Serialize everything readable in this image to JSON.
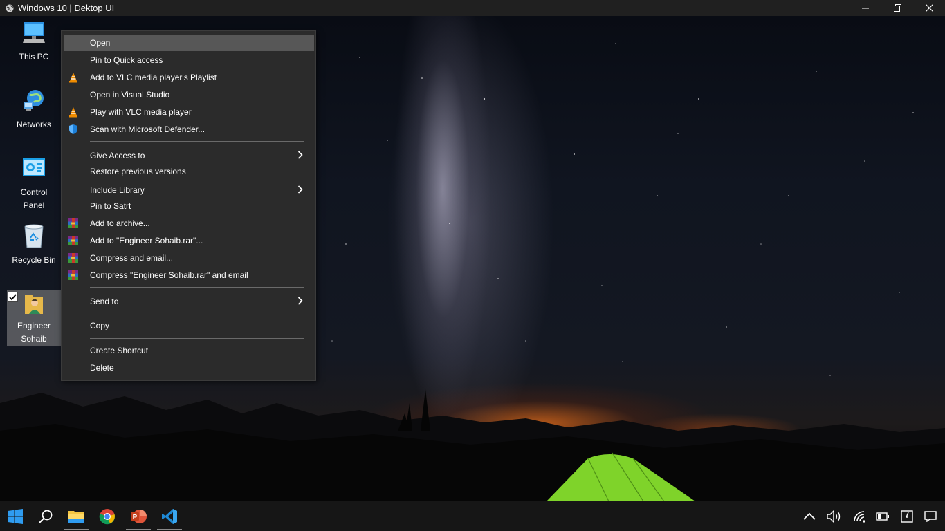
{
  "window": {
    "title": "Windows 10 | Dektop UI"
  },
  "desktop_icons": [
    {
      "label": "This PC",
      "icon": "computer-icon"
    },
    {
      "label": "Networks",
      "icon": "network-icon"
    },
    {
      "label": "Control Panel",
      "icon": "control-panel-icon"
    },
    {
      "label": "Recycle Bin",
      "icon": "recycle-bin-icon"
    },
    {
      "label": "Engineer Sohaib",
      "icon": "user-folder-icon",
      "selected": true,
      "checked": true
    }
  ],
  "context_menu": {
    "items": [
      {
        "label": "Open",
        "highlighted": true
      },
      {
        "label": "Pin to Quick access"
      },
      {
        "label": "Add to VLC media player's Playlist",
        "icon": "vlc-icon"
      },
      {
        "label": "Open in Visual Studio"
      },
      {
        "label": "Play with VLC media player",
        "icon": "vlc-icon"
      },
      {
        "label": "Scan with Microsoft Defender...",
        "icon": "defender-shield-icon"
      },
      {
        "label": "Give Access to",
        "submenu": true
      },
      {
        "label": "Restore previous versions"
      },
      {
        "label": "Include Library",
        "submenu": true
      },
      {
        "label": "Pin to Satrt"
      },
      {
        "label": "Add to archive...",
        "icon": "winrar-icon"
      },
      {
        "label": "Add to \"Engineer Sohaib.rar\"...",
        "icon": "winrar-icon"
      },
      {
        "label": "Compress and email...",
        "icon": "winrar-icon"
      },
      {
        "label": "Compress \"Engineer Sohaib.rar\" and email",
        "icon": "winrar-icon"
      },
      {
        "label": "Send to",
        "submenu": true
      },
      {
        "label": "Copy"
      },
      {
        "label": "Create Shortcut"
      },
      {
        "label": "Delete"
      }
    ]
  },
  "taskbar": {
    "apps": [
      "start-icon",
      "search-icon",
      "file-explorer-icon",
      "chrome-icon",
      "powerpoint-icon",
      "vscode-icon"
    ],
    "tray": [
      "chevron-up-icon",
      "volume-icon",
      "wifi-icon",
      "battery-icon",
      "clock-icon",
      "notification-icon"
    ]
  },
  "colors": {
    "menu_bg": "#2b2b2b",
    "menu_highlight": "#575757",
    "taskbar_bg": "#161616",
    "titlebar_bg": "#202020"
  }
}
